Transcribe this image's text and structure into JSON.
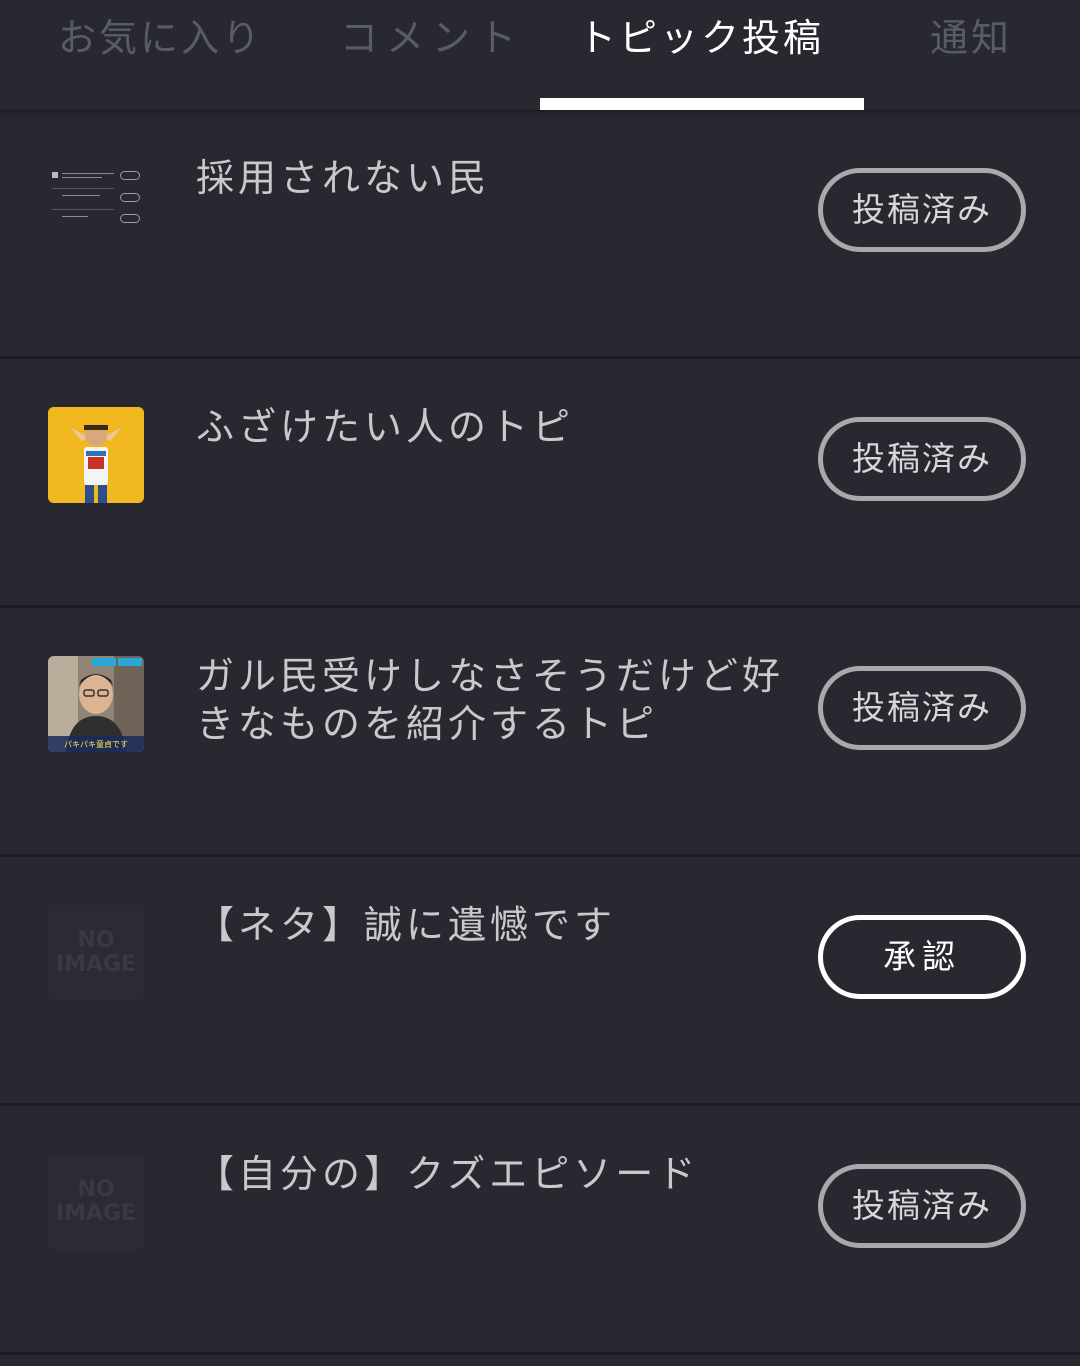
{
  "tabs": {
    "favorites": "お気に入り",
    "comments": "コメント",
    "topic_posts": "トピック投稿",
    "notifications": "通知",
    "active": "topic_posts"
  },
  "items": [
    {
      "title": "採用されない民",
      "thumbnail": "document-screenshot",
      "status": "投稿済み"
    },
    {
      "title": "ふざけたい人のトピ",
      "thumbnail": "person-photo",
      "status": "投稿済み"
    },
    {
      "title": "ガル民受けしなさそうだけど好きなものを紹介するトピ",
      "thumbnail": "news-photo",
      "thumbnail_caption": "パキパキ童貞です",
      "status": "投稿済み"
    },
    {
      "title": "【ネタ】誠に遺憾です",
      "thumbnail": "no-image",
      "thumbnail_text": "NO IMAGE",
      "status": "承認"
    },
    {
      "title": "【自分の】クズエピソード",
      "thumbnail": "no-image",
      "thumbnail_text": "NO IMAGE",
      "status": "投稿済み"
    }
  ],
  "colors": {
    "background": "#272830",
    "divider": "#1d1e24",
    "active_tab": "#ffffff",
    "inactive_tab": "#5a5c63",
    "button_border": "#a9a9ad",
    "approve_border": "#ffffff"
  }
}
